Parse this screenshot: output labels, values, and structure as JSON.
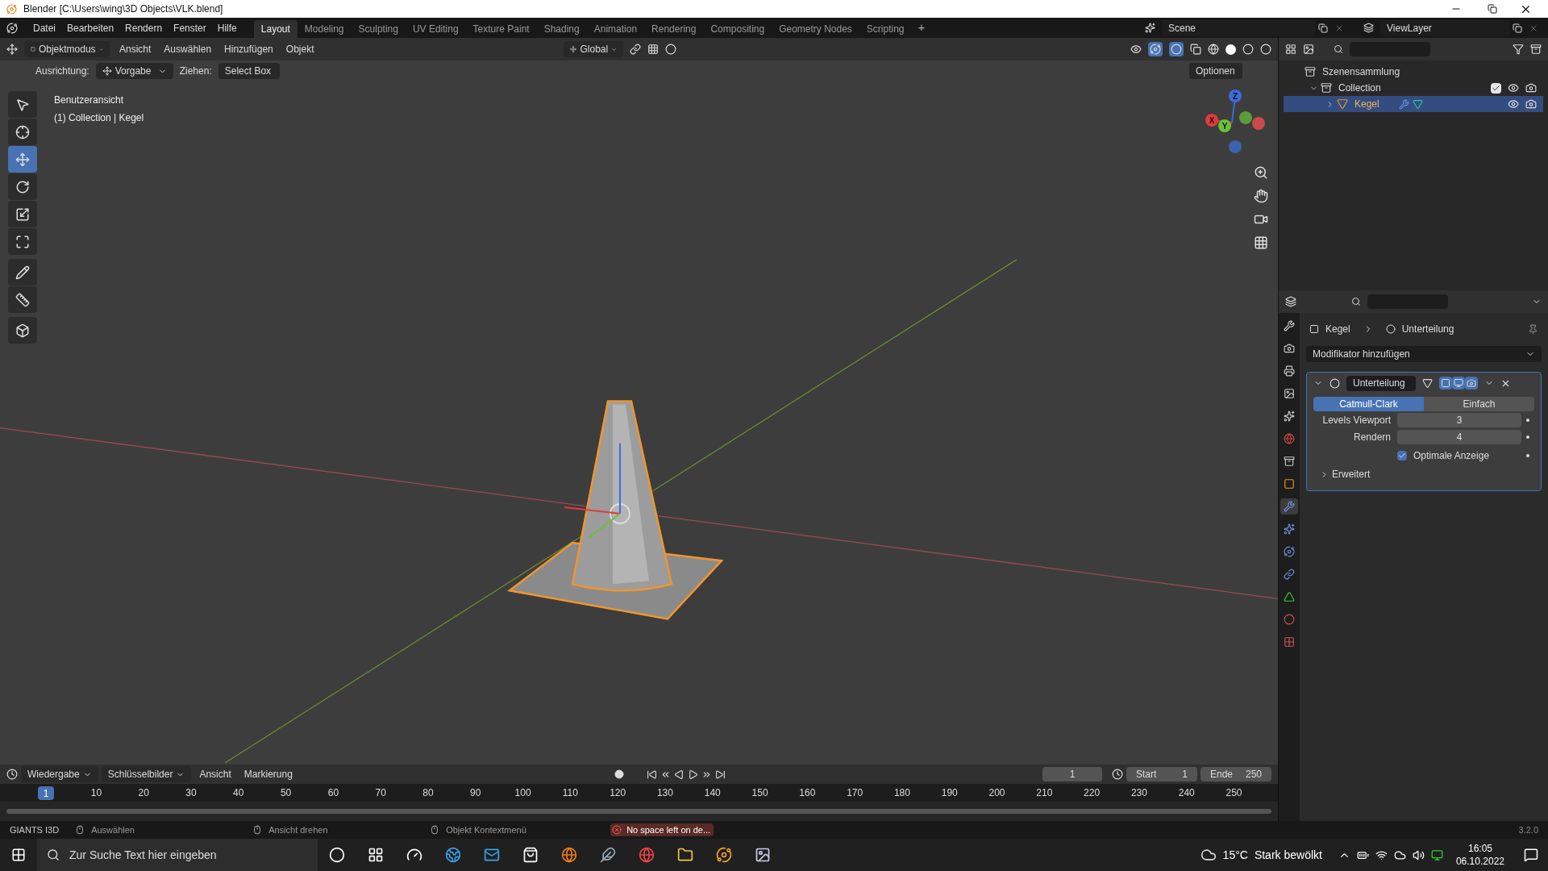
{
  "title_bar": {
    "title": "Blender [C:\\Users\\wing\\3D Objects\\VLK.blend]"
  },
  "menu_bar": {
    "menus": [
      "Datei",
      "Bearbeiten",
      "Rendern",
      "Fenster",
      "Hilfe"
    ],
    "workspaces": [
      {
        "label": "Layout",
        "selected": true
      },
      {
        "label": "Modeling",
        "selected": false
      },
      {
        "label": "Sculpting",
        "selected": false
      },
      {
        "label": "UV Editing",
        "selected": false
      },
      {
        "label": "Texture Paint",
        "selected": false
      },
      {
        "label": "Shading",
        "selected": false
      },
      {
        "label": "Animation",
        "selected": false
      },
      {
        "label": "Rendering",
        "selected": false
      },
      {
        "label": "Compositing",
        "selected": false
      },
      {
        "label": "Geometry Nodes",
        "selected": false
      },
      {
        "label": "Scripting",
        "selected": false
      }
    ],
    "add_workspace": "+",
    "scene": "Scene",
    "view_layer": "ViewLayer"
  },
  "viewport_header": {
    "mode": "Objektmodus",
    "menus": [
      "Ansicht",
      "Auswählen",
      "Hinzufügen",
      "Objekt"
    ],
    "orientation": "Global"
  },
  "tool_settings": {
    "orientation_label": "Ausrichtung:",
    "orientation": "Vorgabe",
    "drag_label": "Ziehen:",
    "drag": "Select Box",
    "options": "Optionen"
  },
  "viewport": {
    "overlay_text": [
      "Benutzeransicht",
      "(1) Collection | Kegel"
    ],
    "tools": [
      {
        "selected": false
      },
      {
        "selected": false
      },
      {
        "selected": true
      },
      {
        "selected": false
      },
      {
        "selected": false
      },
      {
        "selected": false
      },
      {
        "selected": false
      },
      {
        "selected": false
      },
      {
        "selected": false
      }
    ],
    "gizmo_labels": [
      "Z",
      "Y",
      "X"
    ]
  },
  "outliner": {
    "items": [
      {
        "label": "Szenensammlung",
        "children": [
          {
            "label": "Collection",
            "expanded": true,
            "checked": true,
            "selected": false,
            "children": [
              {
                "label": "Kegel",
                "expanded": false,
                "selected": true
              }
            ]
          }
        ]
      }
    ]
  },
  "properties": {
    "tabs": [
      {
        "selected": false
      },
      {
        "selected": false
      },
      {
        "selected": false
      },
      {
        "selected": false
      },
      {
        "selected": false
      },
      {
        "selected": false
      },
      {
        "selected": false
      },
      {
        "selected": false
      },
      {
        "selected": true
      },
      {
        "selected": false
      },
      {
        "selected": false
      },
      {
        "selected": false
      },
      {
        "selected": false
      },
      {
        "selected": false
      },
      {
        "selected": false
      }
    ],
    "breadcrumb": [
      "Kegel",
      "Unterteilung"
    ],
    "add_modifier": "Modifikator hinzufügen",
    "modifier": {
      "name": "Unterteilung",
      "expanded": true,
      "types": [
        {
          "label": "Catmull-Clark",
          "selected": true
        },
        {
          "label": "Einfach",
          "selected": false
        }
      ],
      "fields": [
        {
          "label": "Levels Viewport",
          "value": "3"
        },
        {
          "label": "Rendern",
          "value": "4"
        }
      ],
      "option": {
        "label": "Optimale Anzeige",
        "checked": true
      },
      "advanced": {
        "label": "Erweitert",
        "expanded": false
      }
    }
  },
  "timeline": {
    "menus": [
      "Wiedergabe",
      "Schlüsselbilder",
      "Ansicht",
      "Markierung"
    ],
    "current_frame": "1",
    "start_label": "Start",
    "start": "1",
    "end_label": "Ende",
    "end": "250",
    "playhead": "1",
    "ticks": [
      "10",
      "20",
      "30",
      "40",
      "50",
      "60",
      "70",
      "80",
      "90",
      "100",
      "110",
      "120",
      "130",
      "140",
      "150",
      "160",
      "170",
      "180",
      "190",
      "200",
      "210",
      "220",
      "230",
      "240",
      "250"
    ]
  },
  "status_bar": {
    "app": "GIANTS I3D",
    "hints": [
      "Auswählen",
      "Ansicht drehen",
      "Objekt Kontextmenü"
    ],
    "error": "No space left on de...",
    "version": "3.2.0"
  },
  "taskbar": {
    "search_placeholder": "Zur Suche Text hier eingeben",
    "temperature": "15°C",
    "weather": "Stark bewölkt",
    "time": "16:05",
    "date": "06.10.2022"
  }
}
